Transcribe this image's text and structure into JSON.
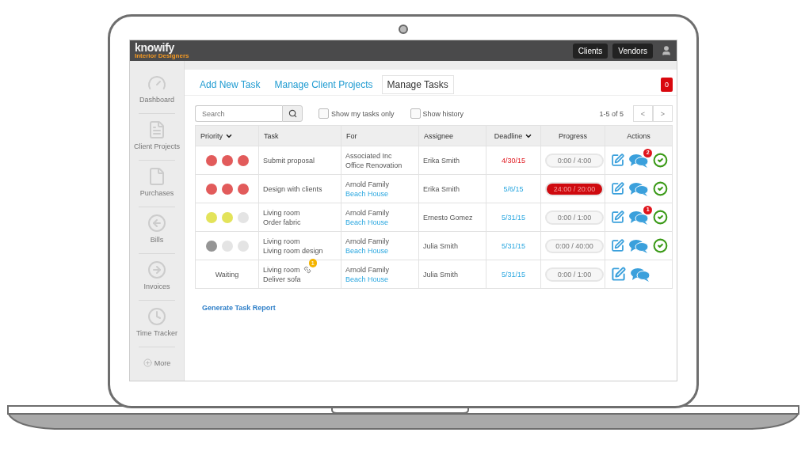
{
  "app": {
    "logo": "knowify",
    "tagline": "Interior Designers"
  },
  "top_nav": [
    {
      "label": "Clients"
    },
    {
      "label": "Vendors"
    }
  ],
  "sidebar": {
    "items": [
      {
        "label": "Dashboard",
        "kind": "gauge"
      },
      {
        "label": "Client Projects",
        "kind": "document"
      },
      {
        "label": "Purchases",
        "kind": "purchase"
      },
      {
        "label": "Bills",
        "kind": "back"
      },
      {
        "label": "Invoices",
        "kind": "forward"
      },
      {
        "label": "Time Tracker",
        "kind": "clock"
      }
    ],
    "more": "More"
  },
  "tabs": [
    {
      "label": "Add New Task",
      "selected": false
    },
    {
      "label": "Manage Client Projects",
      "selected": false
    },
    {
      "label": "Manage Tasks",
      "selected": true
    }
  ],
  "notification_count": "0",
  "search": {
    "placeholder": "Search"
  },
  "filters": [
    {
      "label": "Show my tasks only",
      "checked": false
    },
    {
      "label": "Show history",
      "checked": false
    }
  ],
  "pagination": {
    "range": "1-5 of 5",
    "prev": "<",
    "next": ">"
  },
  "table": {
    "columns": [
      {
        "label": "Priority",
        "sorted": true
      },
      {
        "label": "Task",
        "sorted": false
      },
      {
        "label": "For",
        "sorted": false
      },
      {
        "label": "Assignee",
        "sorted": false
      },
      {
        "label": "Deadline",
        "sorted": true
      },
      {
        "label": "Progress",
        "sorted": false
      },
      {
        "label": "Actions",
        "sorted": false
      }
    ],
    "rows": [
      {
        "priority": {
          "kind": "dots",
          "dots": [
            {
              "color": "#e25b5b"
            },
            {
              "color": "#e25b5b"
            },
            {
              "color": "#e25b5b"
            }
          ]
        },
        "task": [
          "Submit proposal"
        ],
        "linked": false,
        "client": "Associated Inc",
        "project": "Office Renovation",
        "project_link": false,
        "assignee": "Erika Smith",
        "deadline": "4/30/15",
        "overdue": true,
        "progress": "0:00 / 4:00",
        "over_budget": false,
        "comments": "2",
        "completable": true
      },
      {
        "priority": {
          "kind": "dots",
          "dots": [
            {
              "color": "#e25b5b"
            },
            {
              "color": "#e25b5b"
            },
            {
              "color": "#e25b5b"
            }
          ]
        },
        "task": [
          "Design with clients"
        ],
        "linked": false,
        "client": "Arnold Family",
        "project": "Beach House",
        "project_link": true,
        "assignee": "Erika Smith",
        "deadline": "5/6/15",
        "overdue": false,
        "progress": "24:00 / 20:00",
        "over_budget": true,
        "completable": true
      },
      {
        "priority": {
          "kind": "dots",
          "dots": [
            {
              "color": "#e3e35a"
            },
            {
              "color": "#e3e35a"
            },
            {
              "color": "#e4e4e4"
            }
          ]
        },
        "task": [
          "Living room",
          "Order fabric"
        ],
        "linked": false,
        "client": "Arnold Family",
        "project": "Beach House",
        "project_link": true,
        "assignee": "Ernesto Gomez",
        "deadline": "5/31/15",
        "overdue": false,
        "progress": "0:00 / 1:00",
        "over_budget": false,
        "comments": "1",
        "completable": true
      },
      {
        "priority": {
          "kind": "dots",
          "dots": [
            {
              "color": "#959595"
            },
            {
              "color": "#e4e4e4"
            },
            {
              "color": "#e4e4e4"
            }
          ]
        },
        "task": [
          "Living room",
          "Living room design"
        ],
        "linked": false,
        "client": "Arnold Family",
        "project": "Beach House",
        "project_link": true,
        "assignee": "Julia Smith",
        "deadline": "5/31/15",
        "overdue": false,
        "progress": "0:00 / 40:00",
        "over_budget": false,
        "completable": true
      },
      {
        "priority": {
          "kind": "text",
          "text": "Waiting"
        },
        "task": [
          "Living room",
          "Deliver sofa"
        ],
        "linked": true,
        "link_count": "1",
        "client": "Arnold Family",
        "project": "Beach House",
        "project_link": true,
        "assignee": "Julia Smith",
        "deadline": "5/31/15",
        "overdue": false,
        "progress": "0:00 / 1:00",
        "over_budget": false,
        "completable": false
      }
    ]
  },
  "report_link": "Generate Task Report"
}
